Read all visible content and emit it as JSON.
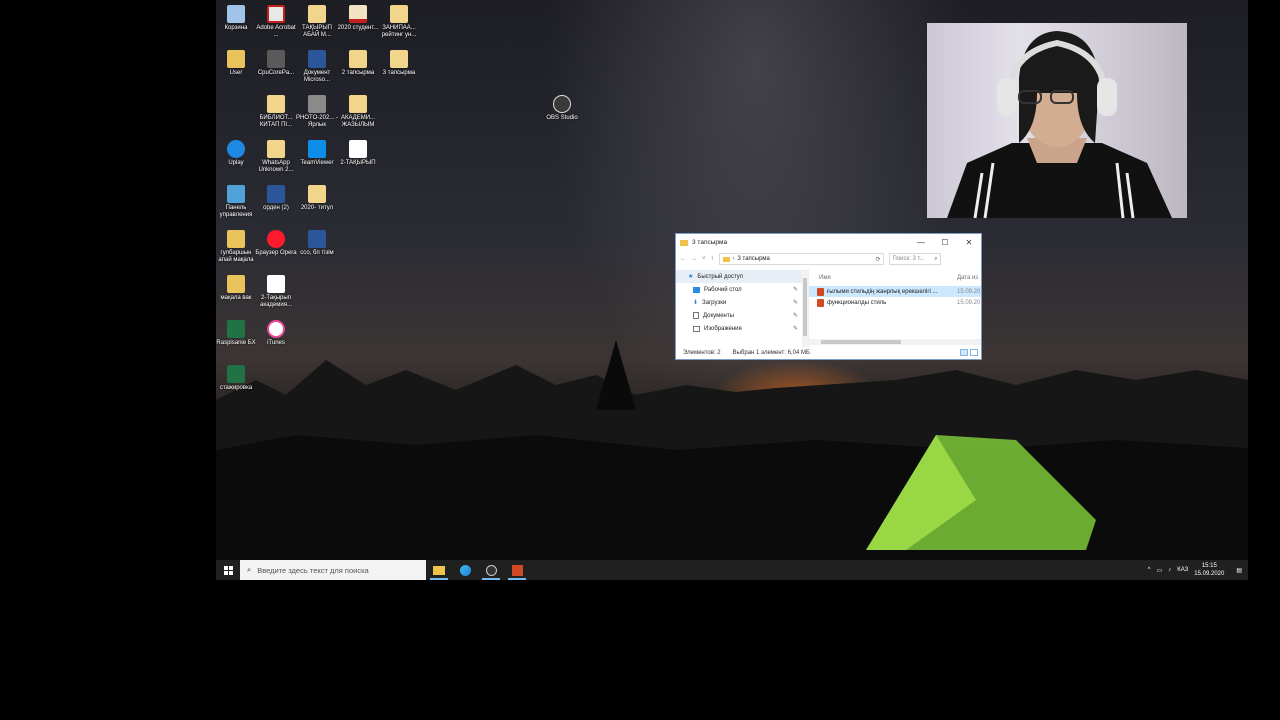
{
  "desktop": {
    "icons": [
      {
        "label": "Корзина"
      },
      {
        "label": "Adobe Acrobat ..."
      },
      {
        "label": "ТАҚЫРЫП АБАЙ М..."
      },
      {
        "label": "2020 студент..."
      },
      {
        "label": "ЗАНИПАА... рейтинг ун..."
      },
      {
        "label": "User"
      },
      {
        "label": "CpuCorePa..."
      },
      {
        "label": "Документ Microso..."
      },
      {
        "label": "2 тапсырма"
      },
      {
        "label": "3 тапсырма"
      },
      {
        "label": "БИБЛИОТ... КИТАП ПІ..."
      },
      {
        "label": "PHOTO-202... - Ярлык"
      },
      {
        "label": "АКАДЕМИ... ЖАЗЫЛЫМ"
      },
      {
        "label": "OBS Studio"
      },
      {
        "label": "Uplay"
      },
      {
        "label": "WhatsApp Unknown 2..."
      },
      {
        "label": "TeamViewer"
      },
      {
        "label": "2-ТАҚЫРЫП"
      },
      {
        "label": "Панель управления"
      },
      {
        "label": "орден (2)"
      },
      {
        "label": "2020- титул"
      },
      {
        "label": "гулбаршын апай мақала"
      },
      {
        "label": "Браузер Opera"
      },
      {
        "label": "ссо, бп тізім"
      },
      {
        "label": "мақала вак"
      },
      {
        "label": "2-Тақырып академия..."
      },
      {
        "label": "Raspisanie БХ"
      },
      {
        "label": "iTunes"
      },
      {
        "label": "стажировка"
      }
    ]
  },
  "explorer": {
    "title": "3 тапсырма",
    "minimize": "—",
    "maximize": "☐",
    "close": "✕",
    "address": "3 тапсырма",
    "search_placeholder": "Поиск: 3 т...",
    "nav": [
      {
        "label": "Быстрый доступ"
      },
      {
        "label": "Рабочий стол"
      },
      {
        "label": "Загрузки"
      },
      {
        "label": "Документы"
      },
      {
        "label": "Изображения"
      }
    ],
    "columns": {
      "name": "Имя",
      "date": "Дата из"
    },
    "files": [
      {
        "name": "ғылыми стильдің жанрлық ерекшелігі ...",
        "date": "15.09.20"
      },
      {
        "name": "функционалды стиль",
        "date": "15.09.20"
      }
    ],
    "status": {
      "count": "Элементов: 2",
      "selected": "Выбран 1 элемент: 6,04 МБ"
    }
  },
  "taskbar": {
    "search_placeholder": "Введите здесь текст для поиска",
    "tray": {
      "lang": "КАЗ",
      "time": "15:15",
      "date": "15.09.2020"
    }
  },
  "colors": {
    "accent": "#0078d7",
    "selection": "#cce8ff",
    "taskbar": "#202020"
  }
}
